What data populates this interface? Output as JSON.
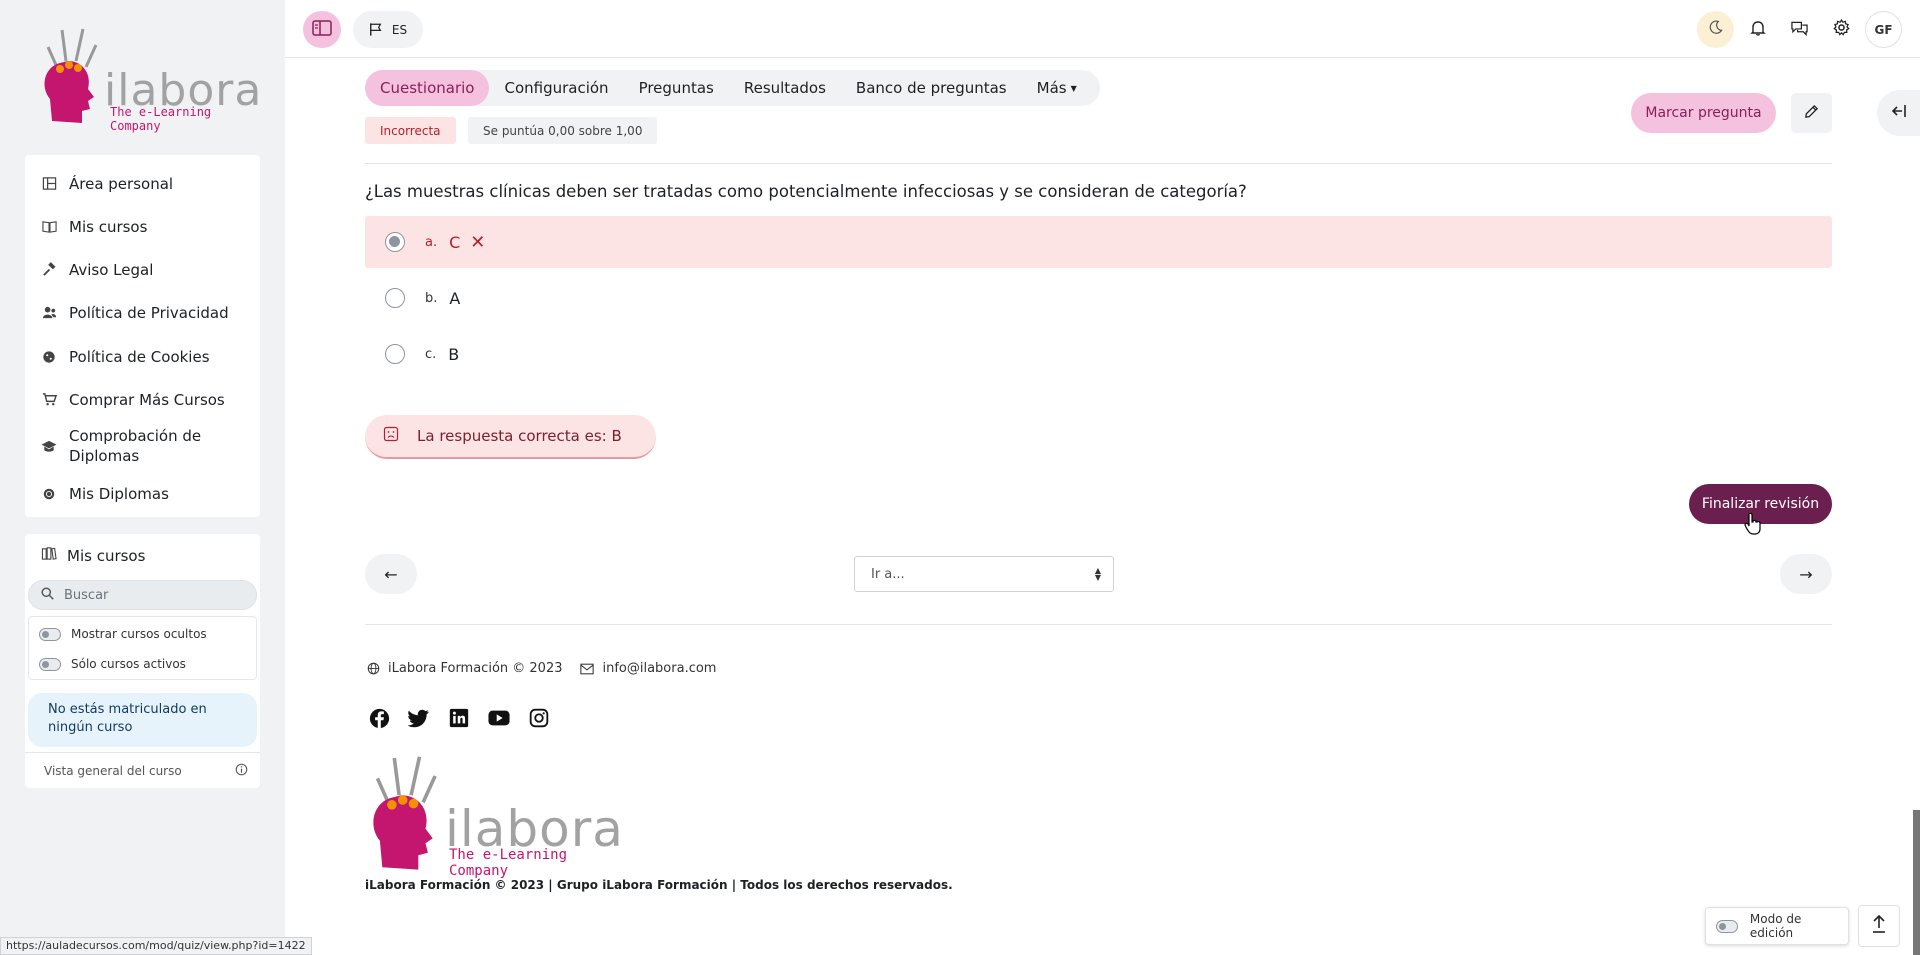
{
  "brand": {
    "name": "ilabora",
    "tagline": "The e-Learning Company"
  },
  "topbar": {
    "language": "ES",
    "user_initials": "GF"
  },
  "nav": {
    "items": [
      {
        "label": "Área personal",
        "icon": "dashboard-icon"
      },
      {
        "label": "Mis cursos",
        "icon": "book-icon"
      },
      {
        "label": "Aviso Legal",
        "icon": "gavel-icon"
      },
      {
        "label": "Política de Privacidad",
        "icon": "users-icon"
      },
      {
        "label": "Política de Cookies",
        "icon": "cookie-icon"
      },
      {
        "label": "Comprar Más Cursos",
        "icon": "cart-icon"
      },
      {
        "label": "Comprobación de Diplomas",
        "icon": "graduation-icon"
      },
      {
        "label": "Mis Diplomas",
        "icon": "certificate-icon"
      }
    ]
  },
  "courses_block": {
    "title": "Mis cursos",
    "search_placeholder": "Buscar",
    "toggle_hidden": "Mostrar cursos ocultos",
    "toggle_active": "Sólo cursos activos",
    "empty_message": "No estás matriculado en ningún curso",
    "overview": "Vista general del curso"
  },
  "tabs": [
    {
      "label": "Cuestionario",
      "active": true
    },
    {
      "label": "Configuración",
      "active": false
    },
    {
      "label": "Preguntas",
      "active": false
    },
    {
      "label": "Resultados",
      "active": false
    },
    {
      "label": "Banco de preguntas",
      "active": false
    },
    {
      "label": "Más",
      "active": false
    }
  ],
  "question": {
    "status": "Incorrecta",
    "score": "Se puntúa 0,00 sobre 1,00",
    "mark_label": "Marcar pregunta",
    "text": "¿Las muestras clínicas deben ser tratadas como potencialmente infecciosas y se consideran de categoría?",
    "answers": [
      {
        "letter": "a.",
        "text": "C",
        "selected": true,
        "wrong": true
      },
      {
        "letter": "b.",
        "text": "A",
        "selected": false,
        "wrong": false
      },
      {
        "letter": "c.",
        "text": "B",
        "selected": false,
        "wrong": false
      }
    ],
    "feedback": "La respuesta correcta es: B"
  },
  "actions": {
    "finish": "Finalizar revisión",
    "goto": "Ir a..."
  },
  "footer": {
    "company": "iLabora Formación © 2023",
    "email": "info@ilabora.com",
    "copyright": "iLabora Formación © 2023 | Grupo iLabora Formación | Todos los derechos reservados.",
    "edit_mode": "Modo de edición"
  },
  "status_url": "https://auladecursos.com/mod/quiz/view.php?id=1422",
  "colors": {
    "accent": "#f4c2de",
    "primary": "#6b1f4f",
    "danger": "#b21f2d",
    "brand_magenta": "#c4166f",
    "brand_orange": "#f39200"
  }
}
